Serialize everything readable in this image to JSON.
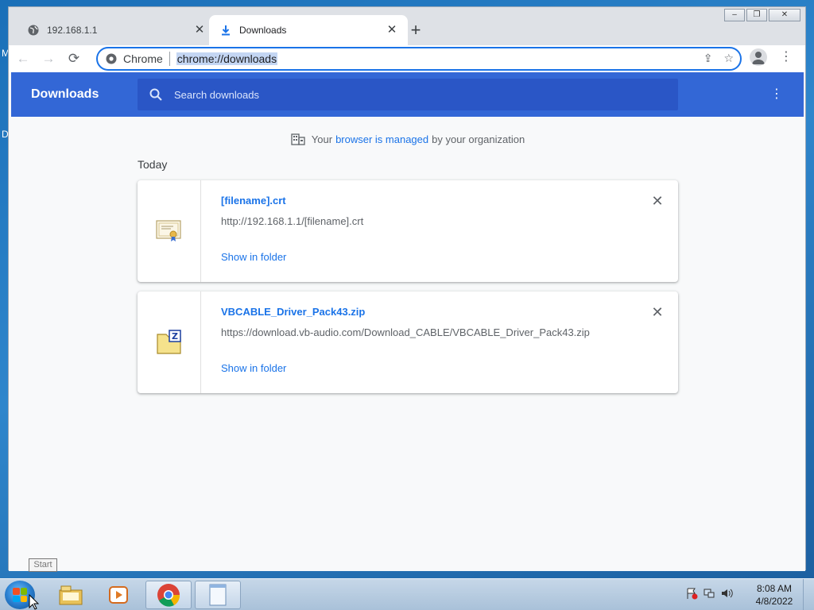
{
  "desktop": {
    "edge_letters": [
      "M",
      "D"
    ]
  },
  "window": {
    "controls": {
      "minimize": "‒",
      "restore": "❐",
      "close": "✕"
    }
  },
  "tabs": [
    {
      "title": "192.168.1.1",
      "icon": "globe-icon",
      "active": false
    },
    {
      "title": "Downloads",
      "icon": "download-icon",
      "active": true
    }
  ],
  "toolbar": {
    "back": "←",
    "forward": "→",
    "reload": "⟳",
    "omnibox_chip": "Chrome",
    "url": "chrome://downloads",
    "share": "⇪",
    "bookmark": "☆",
    "menu": "⋮"
  },
  "downloads_page": {
    "title": "Downloads",
    "search_placeholder": "Search downloads",
    "more": "⋮",
    "managed": {
      "prefix": "Your",
      "link": "browser is managed",
      "suffix": "by your organization"
    },
    "date_header": "Today",
    "items": [
      {
        "name": "[filename].crt",
        "url": "http://192.168.1.1/[filename].crt",
        "action": "Show in folder",
        "icon": "certificate-icon",
        "remove": "✕"
      },
      {
        "name": "VBCABLE_Driver_Pack43.zip",
        "url": "https://download.vb-audio.com/Download_CABLE/VBCABLE_Driver_Pack43.zip",
        "action": "Show in folder",
        "icon": "zip-archive-icon",
        "remove": "✕"
      }
    ]
  },
  "taskbar": {
    "tooltip": "Start",
    "pinned": [
      "windows-explorer-icon",
      "media-player-icon",
      "chrome-icon",
      "notepad-icon"
    ],
    "clock_time": "8:08 AM",
    "clock_date": "4/8/2022"
  },
  "colors": {
    "accent": "#3367d6",
    "link": "#1a73e8",
    "taskbar": "#b8cde2"
  }
}
